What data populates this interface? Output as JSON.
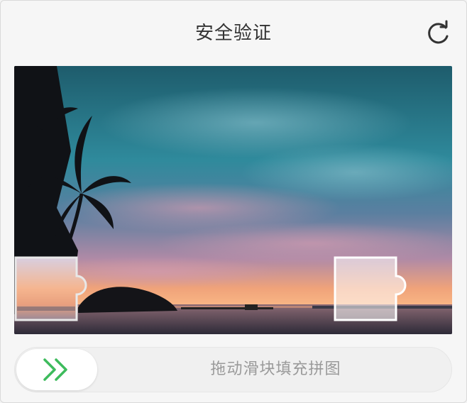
{
  "dialog": {
    "title": "安全验证",
    "refresh_icon": "refresh-icon"
  },
  "puzzle": {
    "image": "sunset-beach-palm-trees",
    "piece_icon": "puzzle-piece",
    "target_icon": "puzzle-slot"
  },
  "slider": {
    "hint": "拖动滑块填充拼图",
    "handle_icon": "double-chevron-right-icon",
    "accent_color": "#3dbb5c"
  }
}
